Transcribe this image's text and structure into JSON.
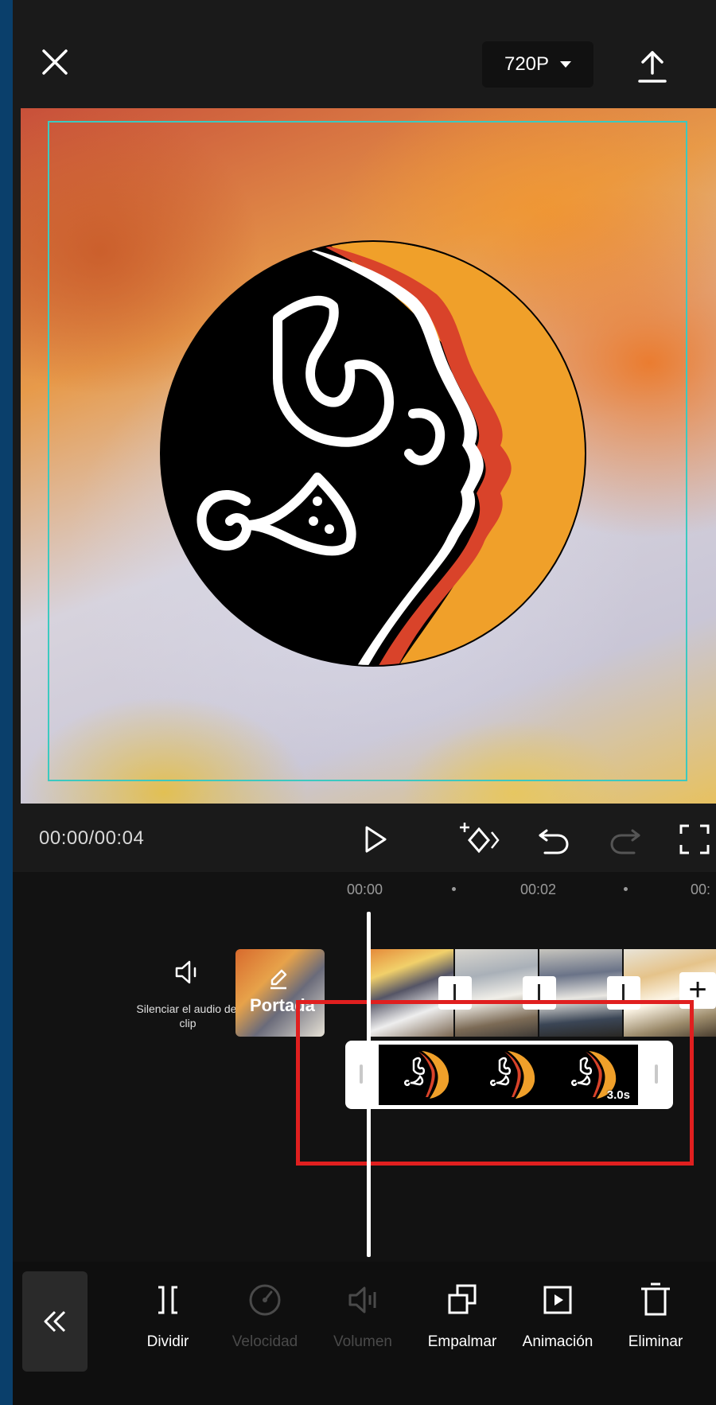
{
  "header": {
    "resolution": "720P"
  },
  "playback": {
    "timecode": "00:00/00:04"
  },
  "timeline": {
    "ruler": [
      "00:00",
      "00:02",
      "00:"
    ],
    "mute_label": "Silenciar el audio del clip",
    "cover_label": "Portada",
    "overlay_duration": "3.0s"
  },
  "toolbar": {
    "items": [
      {
        "label": "Dividir",
        "icon": "split-icon",
        "enabled": true
      },
      {
        "label": "Velocidad",
        "icon": "speed-icon",
        "enabled": false
      },
      {
        "label": "Volumen",
        "icon": "volume-icon",
        "enabled": false
      },
      {
        "label": "Empalmar",
        "icon": "overlay-icon",
        "enabled": true
      },
      {
        "label": "Animación",
        "icon": "animation-icon",
        "enabled": true
      },
      {
        "label": "Eliminar",
        "icon": "trash-icon",
        "enabled": true
      }
    ]
  },
  "colors": {
    "accent_guide": "#3cc9c0",
    "highlight": "#e01f1f",
    "logo_orange": "#f0a02a",
    "logo_red": "#d9432a"
  }
}
